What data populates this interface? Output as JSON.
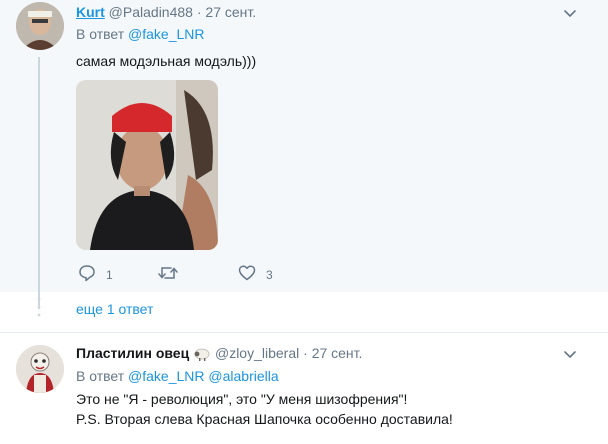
{
  "tweet1": {
    "display_name": "Kurt",
    "handle": "@Paladin488",
    "separator": "·",
    "date": "27 сент.",
    "reply_prefix": "В ответ",
    "reply_to": "@fake_LNR",
    "text": "самая модэльная модэль)))",
    "reply_count": "1",
    "retweet_count": "",
    "like_count": "3"
  },
  "more_replies": "еще 1 ответ",
  "tweet2": {
    "display_name": "Пластилин овец",
    "handle": "@zloy_liberal",
    "separator": "·",
    "date": "27 сент.",
    "reply_prefix": "В ответ",
    "reply_to_1": "@fake_LNR",
    "reply_to_2": "@alabriella",
    "line1": "Это не \"Я - революция\", это \"У меня шизофрения\"!",
    "line2": "P.S. Вторая слева Красная Шапочка особенно доставила!"
  },
  "icons": {
    "menu": "chevron-down-icon",
    "reply": "reply-icon",
    "retweet": "retweet-icon",
    "like": "heart-icon",
    "sheep": "sheep-emoji-icon"
  },
  "colors": {
    "link": "#1b95e0",
    "muted": "#657786",
    "thread_bg": "#f5f8fa"
  }
}
